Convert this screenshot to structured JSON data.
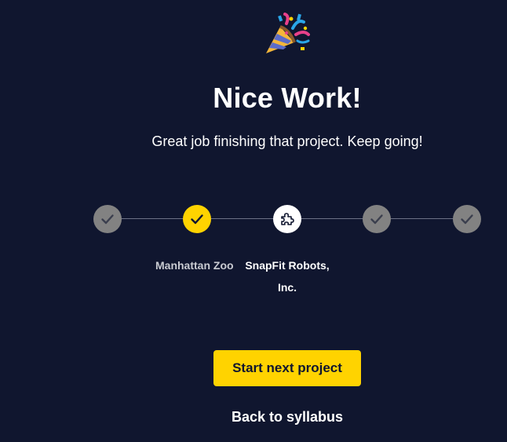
{
  "celebration": {
    "icon": "party-popper-icon"
  },
  "header": {
    "title": "Nice Work!",
    "subtitle": "Great job finishing that project. Keep going!"
  },
  "progress": {
    "steps": [
      {
        "status": "completed",
        "icon": "check-icon"
      },
      {
        "status": "just-completed",
        "icon": "check-icon",
        "label": "Manhattan Zoo"
      },
      {
        "status": "current",
        "icon": "puzzle-piece-icon",
        "label_line1": "SnapFit Robots,",
        "label_line2": "Inc."
      },
      {
        "status": "completed",
        "icon": "check-icon"
      },
      {
        "status": "completed",
        "icon": "check-icon"
      }
    ]
  },
  "actions": {
    "next_label": "Start next project",
    "back_label": "Back to syllabus"
  },
  "colors": {
    "background": "#10162f",
    "accent": "#ffd300",
    "step_done": "#828282",
    "text": "#ffffff"
  }
}
